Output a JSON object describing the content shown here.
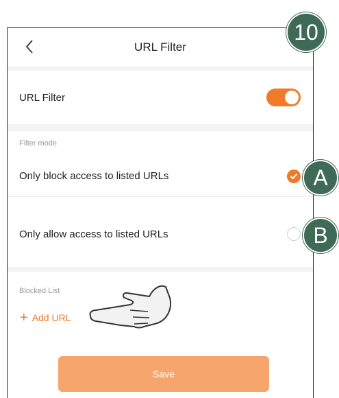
{
  "header": {
    "title": "URL Filter",
    "back_icon": "chevron-left-icon"
  },
  "url_filter": {
    "label": "URL Filter",
    "enabled": true
  },
  "filter_mode": {
    "section_label": "Filter mode",
    "options": [
      {
        "label": "Only block access to listed URLs",
        "selected": true
      },
      {
        "label": "Only allow access to listed URLs",
        "selected": false
      }
    ]
  },
  "blocked_list": {
    "section_label": "Blocked List",
    "add_label": "Add URL",
    "add_icon": "plus-icon"
  },
  "save_label": "Save",
  "callouts": {
    "step": "10",
    "a": "A",
    "b": "B"
  },
  "colors": {
    "accent": "#f07a2a",
    "save_button": "#f6a66c",
    "badge": "#3f6a55"
  }
}
